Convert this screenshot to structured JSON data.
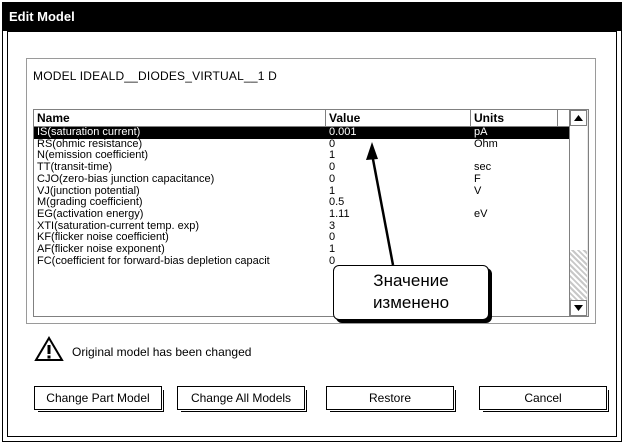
{
  "window": {
    "title": "Edit Model"
  },
  "model": {
    "name": "MODEL IDEALD__DIODES_VIRTUAL__1 D"
  },
  "table": {
    "headers": [
      "Name",
      "Value",
      "Units"
    ],
    "rows": [
      {
        "name": "IS(saturation current)",
        "value": "0.001",
        "units": "pA",
        "selected": true
      },
      {
        "name": "RS(ohmic resistance)",
        "value": "0",
        "units": "Ohm"
      },
      {
        "name": "N(emission coefficient)",
        "value": "1",
        "units": ""
      },
      {
        "name": "TT(transit-time)",
        "value": "0",
        "units": "sec"
      },
      {
        "name": "CJO(zero-bias junction capacitance)",
        "value": "0",
        "units": "F"
      },
      {
        "name": "VJ(junction potential)",
        "value": "1",
        "units": "V"
      },
      {
        "name": "M(grading coefficient)",
        "value": "0.5",
        "units": ""
      },
      {
        "name": "EG(activation energy)",
        "value": "1.11",
        "units": "eV"
      },
      {
        "name": "XTI(saturation-current temp. exp)",
        "value": "3",
        "units": ""
      },
      {
        "name": "KF(flicker noise coefficient)",
        "value": "0",
        "units": ""
      },
      {
        "name": "AF(flicker noise exponent)",
        "value": "1",
        "units": ""
      },
      {
        "name": "FC(coefficient for forward-bias depletion capacit",
        "value": "0",
        "units": ""
      }
    ]
  },
  "callout": {
    "line1": "Значение",
    "line2": "изменено"
  },
  "warning": {
    "icon": "warning-icon",
    "text": "Original model has been changed"
  },
  "buttons": {
    "change_part": "Change Part Model",
    "change_all": "Change All Models",
    "restore": "Restore",
    "cancel": "Cancel"
  },
  "scroll": {
    "up_icon": "scroll-up-icon",
    "down_icon": "scroll-down-icon"
  }
}
